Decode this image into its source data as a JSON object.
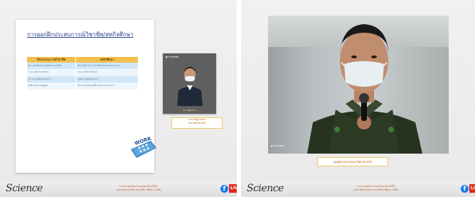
{
  "left": {
    "slide": {
      "title": "การออกฝึกประสบการณ์วิชาชีพ/สหกิจศึกษา",
      "col1_header": "ฝึกประสบการณ์วิชาชีพ",
      "col2_header": "สหกิจศึกษา",
      "rows": [
        [
          "ฝึกงานต่อเนื่องในภาคฤดูร้อนระหว่างชั้นปี",
          "ฝึกงานเต็มเวลา 1 ภาคการศึกษาในสถานประกอบการ"
        ],
        [
          "ระยะเวลาฝึก 6-8 สัปดาห์",
          "ระยะเวลาฝึก 16 สัปดาห์"
        ],
        [
          "ทำงานตามที่ได้รับมอบหมาย",
          "ปฏิบัติงานเสมือนพนักงาน"
        ],
        [
          "นักศึกษาฝึกตามหลักสูตร",
          "มีอาจารย์นิเทศและพี่เลี้ยงในสถานประกอบการ"
        ]
      ],
      "work_label": "WORK"
    },
    "pip": {
      "tag": "● ถ่ายทอดสด",
      "name": "อาจารย์ผู้บรรยาย"
    },
    "caption": {
      "line1": "อาจารย์ผู้บรรยาย",
      "line2": "คณะวิทยาศาสตร์"
    },
    "footer": {
      "logo": "Science",
      "line1": "การประชุมวิชาการระดับชาติ ครั้งที่ 4",
      "line2": "คณะวิทยาศาสตร์ ประจำปีการศึกษา 2564",
      "fb": "f",
      "live": "LIVE"
    }
  },
  "right": {
    "video": {
      "tag": "● ถ่ายทอดสด"
    },
    "caption": "คุณผู้บรรยาย คณะวิทยาศาสตร์",
    "footer": {
      "logo": "Science",
      "line1": "การประชุมวิชาการระดับชาติ ครั้งที่ 4",
      "line2": "คณะวิทยาศาสตร์ ประจำปีการศึกษา 2564",
      "fb": "f",
      "live": "LIVE"
    }
  }
}
